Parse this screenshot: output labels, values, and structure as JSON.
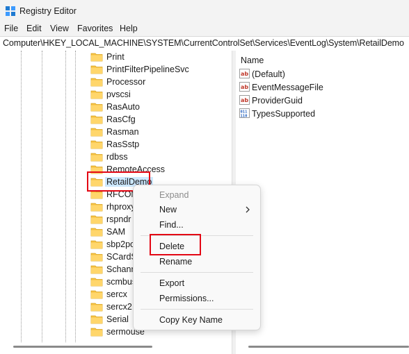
{
  "window": {
    "title": "Registry Editor"
  },
  "menu": {
    "file": "File",
    "edit": "Edit",
    "view": "View",
    "favorites": "Favorites",
    "help": "Help"
  },
  "address": "Computer\\HKEY_LOCAL_MACHINE\\SYSTEM\\CurrentControlSet\\Services\\EventLog\\System\\RetailDemo",
  "tree": {
    "items": [
      "Print",
      "PrintFilterPipelineSvc",
      "Processor",
      "pvscsi",
      "RasAuto",
      "RasCfg",
      "Rasman",
      "RasSstp",
      "rdbss",
      "RemoteAccess",
      "RetailDemo",
      "RFCOM",
      "rhproxy",
      "rspndr",
      "SAM",
      "sbp2po",
      "SCardS",
      "Schann",
      "scmbus",
      "sercx",
      "sercx2",
      "Serial",
      "sermouse"
    ],
    "selected": "RetailDemo"
  },
  "values": {
    "column_name": "Name",
    "items": [
      {
        "name": "(Default)",
        "icon": "string-value-icon"
      },
      {
        "name": "EventMessageFile",
        "icon": "string-value-icon"
      },
      {
        "name": "ProviderGuid",
        "icon": "string-value-icon"
      },
      {
        "name": "TypesSupported",
        "icon": "binary-value-icon"
      }
    ]
  },
  "context_menu": {
    "expand": "Expand",
    "new": "New",
    "find": "Find...",
    "delete": "Delete",
    "rename": "Rename",
    "export": "Export",
    "permissions": "Permissions...",
    "copy_key_name": "Copy Key Name"
  },
  "colors": {
    "highlight_box": "#e30613",
    "selection": "#cce8ff",
    "folder": "#f6c244"
  }
}
